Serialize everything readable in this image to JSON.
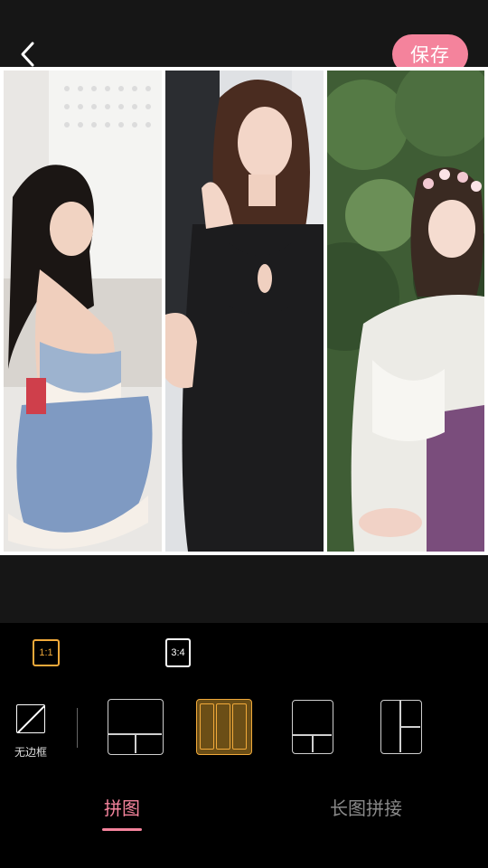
{
  "header": {
    "back_icon": "chevron-left-icon",
    "save_label": "保存"
  },
  "collage": {
    "layout": "three-vertical-columns",
    "photos": [
      {
        "description_icon": "photo-icon"
      },
      {
        "description_icon": "photo-icon"
      },
      {
        "description_icon": "photo-icon"
      }
    ]
  },
  "ratios": [
    {
      "label": "1:1",
      "selected": true
    },
    {
      "label": "3:4",
      "selected": false
    }
  ],
  "border_option": {
    "label": "无边框",
    "icon": "no-border-icon"
  },
  "layouts": {
    "selected_index": 1
  },
  "tabs": [
    {
      "label": "拼图",
      "selected": true
    },
    {
      "label": "长图拼接",
      "selected": false
    }
  ],
  "colors": {
    "accent_pink": "#f4839c",
    "accent_orange": "#f0a93a",
    "background": "#161616"
  }
}
